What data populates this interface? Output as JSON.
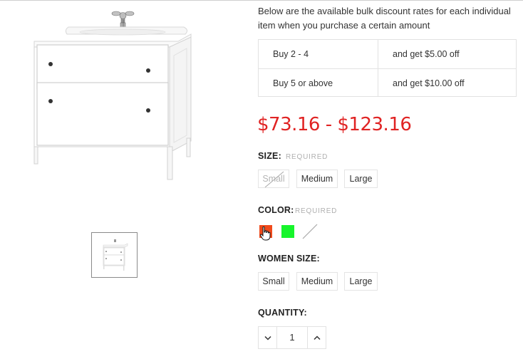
{
  "discounts": {
    "intro": "Below are the available bulk discount rates for each individual item when you purchase a certain amount",
    "rows": [
      {
        "qty": "Buy 2 - 4",
        "offer": "and get $5.00 off"
      },
      {
        "qty": "Buy 5 or above",
        "offer": "and get $10.00 off"
      }
    ]
  },
  "price_range": "$73.16 - $123.16",
  "options": {
    "size": {
      "label": "SIZE:",
      "required": "REQUIRED",
      "values": [
        {
          "label": "Small",
          "available": false
        },
        {
          "label": "Medium",
          "available": true
        },
        {
          "label": "Large",
          "available": true
        }
      ]
    },
    "color": {
      "label": "COLOR:",
      "required": "REQUIRED",
      "swatches": [
        {
          "color": "#f04a1c",
          "available": true
        },
        {
          "color": "#17f52c",
          "available": true
        },
        {
          "color": "none",
          "available": false
        }
      ]
    },
    "women_size": {
      "label": "WOMEN SIZE:",
      "values": [
        {
          "label": "Small"
        },
        {
          "label": "Medium"
        },
        {
          "label": "Large"
        }
      ]
    }
  },
  "quantity": {
    "label": "QUANTITY:",
    "value": "1",
    "decrease_icon": "chevron-down-icon",
    "increase_icon": "chevron-up-icon"
  },
  "images": {
    "main": "bathroom-vanity-cabinet",
    "thumbnail": "bathroom-vanity-cabinet-thumb"
  },
  "colors": {
    "price": "#e02323",
    "border": "#e2e2e2",
    "required_text": "#b0b0b0"
  }
}
